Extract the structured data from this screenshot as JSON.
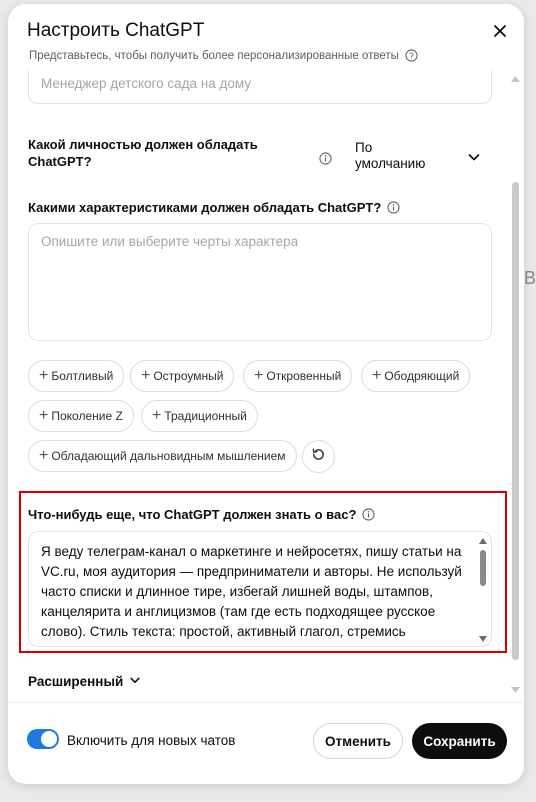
{
  "backdrop": {
    "text": "B"
  },
  "dialog": {
    "title": "Настроить ChatGPT",
    "subtitle": "Представьтесь, чтобы получить более персонализированные ответы",
    "occupation_placeholder": "Менеджер детского сада на дому",
    "personality": {
      "question": "Какой личностью должен обладать ChatGPT?",
      "selected": "По умолчанию"
    },
    "traits": {
      "question": "Какими характеристиками должен обладать ChatGPT?",
      "placeholder": "Опишите или выберите черты характера",
      "chips": [
        "Болтливый",
        "Остроумный",
        "Откровенный",
        "Ободряющий",
        "Поколение Z",
        "Традиционный",
        "Обладающий дальновидным мышлением"
      ]
    },
    "about": {
      "question": "Что-нибудь еще, что ChatGPT должен знать о вас?",
      "value": "Я веду телеграм-канал о маркетинге и нейросетях, пишу статьи на VC.ru, моя аудитория — предприниматели и авторы. Не используй часто списки и длинное тире, избегай лишней воды, штампов, канцелярита и англицизмов (там где есть подходящее русское слово). Стиль текста: простой, активный глагол, стремись"
    },
    "advanced_label": "Расширенный",
    "footer": {
      "toggle_label": "Включить для новых чатов",
      "toggle_on": true,
      "cancel_label": "Отменить",
      "save_label": "Сохранить"
    }
  },
  "colors": {
    "accent": "#1f7ae0",
    "highlight_border": "#d40000",
    "primary_button": "#0d0d0d"
  }
}
